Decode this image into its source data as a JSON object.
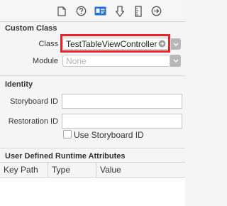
{
  "toolbar": {
    "icons": [
      "file-icon",
      "help-icon",
      "identity-icon",
      "attributes-icon",
      "size-icon",
      "connections-icon"
    ],
    "selected_icon": "identity-icon",
    "accent_color": "#1f6fe0"
  },
  "custom_class": {
    "title": "Custom Class",
    "class_label": "Class",
    "class_value": "TestTableViewController",
    "module_label": "Module",
    "module_placeholder": "None"
  },
  "identity": {
    "title": "Identity",
    "storyboard_id_label": "Storyboard ID",
    "storyboard_id_value": "",
    "restoration_id_label": "Restoration ID",
    "restoration_id_value": "",
    "use_storyboard_id_label": "Use Storyboard ID",
    "use_storyboard_id_checked": false
  },
  "runtime_attributes": {
    "title": "User Defined Runtime Attributes",
    "columns": [
      "Key Path",
      "Type",
      "Value"
    ],
    "rows": []
  },
  "highlight_color": "#e8232a"
}
